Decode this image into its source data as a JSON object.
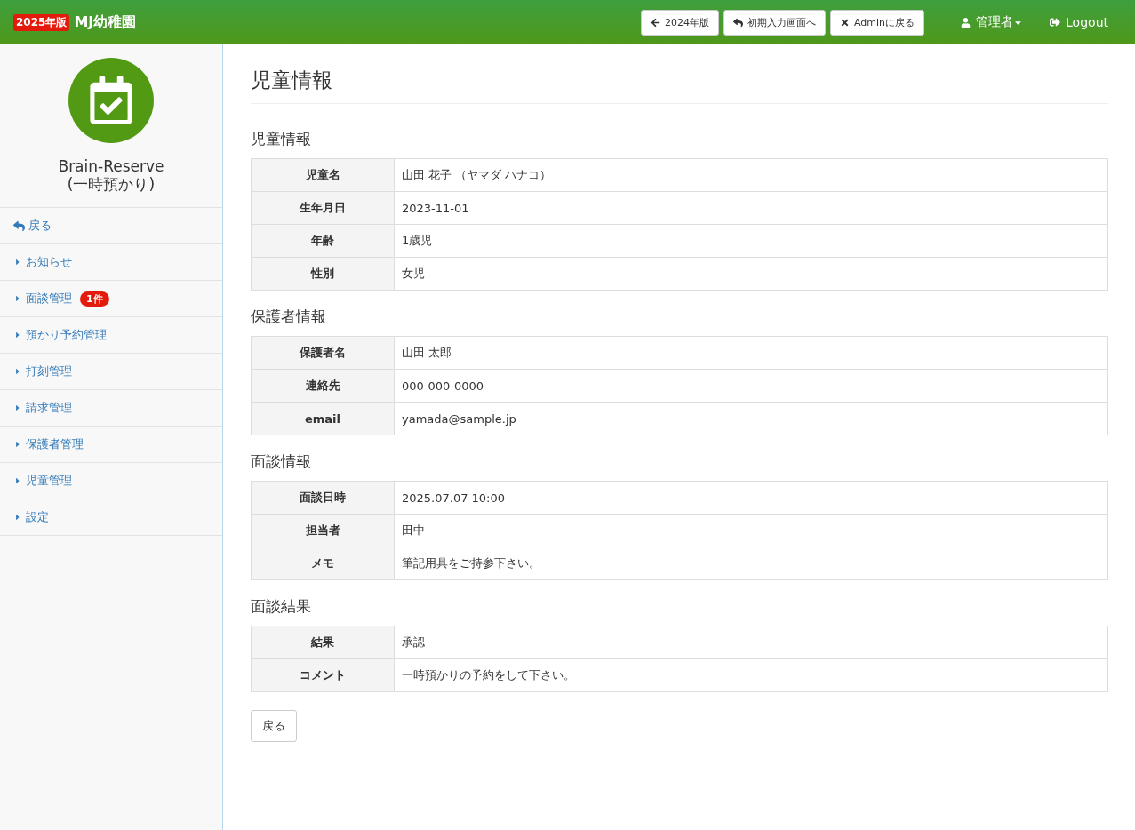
{
  "navbar": {
    "edition_badge": "2025年版",
    "brand": "MJ幼稚園",
    "buttons": [
      {
        "label": "2024年版",
        "kind": "previous"
      },
      {
        "label": "初期入力画面へ",
        "kind": "return"
      },
      {
        "label": "Adminに戻る",
        "kind": "exit"
      }
    ],
    "user_menu": "管理者",
    "logout": "Logout"
  },
  "sidebar": {
    "app_name": "Brain-Reserve",
    "app_subtitle": "(一時預かり)",
    "items": [
      {
        "kind": "back",
        "label": "戻る"
      },
      {
        "kind": "link",
        "label": "お知らせ"
      },
      {
        "kind": "link",
        "label": "面談管理",
        "badge": "1件"
      },
      {
        "kind": "link",
        "label": "預かり予約管理"
      },
      {
        "kind": "link",
        "label": "打刻管理"
      },
      {
        "kind": "link",
        "label": "請求管理"
      },
      {
        "kind": "link",
        "label": "保護者管理"
      },
      {
        "kind": "link",
        "label": "児童管理"
      },
      {
        "kind": "link",
        "label": "設定"
      }
    ]
  },
  "page_title": "児童情報",
  "sections": [
    {
      "heading": "児童情報",
      "rows": [
        {
          "label": "児童名",
          "value": "山田 花子 （ヤマダ ハナコ）"
        },
        {
          "label": "生年月日",
          "value": "2023-11-01"
        },
        {
          "label": "年齢",
          "value": "1歳児"
        },
        {
          "label": "性別",
          "value": "女児"
        }
      ]
    },
    {
      "heading": "保護者情報",
      "rows": [
        {
          "label": "保護者名",
          "value": "山田 太郎"
        },
        {
          "label": "連絡先",
          "value": "000-000-0000"
        },
        {
          "label": "email",
          "value": "yamada@sample.jp"
        }
      ]
    },
    {
      "heading": "面談情報",
      "rows": [
        {
          "label": "面談日時",
          "value": "2025.07.07 10:00"
        },
        {
          "label": "担当者",
          "value": "田中"
        },
        {
          "label": "メモ",
          "value": "筆記用具をご持参下さい。"
        }
      ]
    },
    {
      "heading": "面談結果",
      "rows": [
        {
          "label": "結果",
          "value": "承認"
        },
        {
          "label": "コメント",
          "value": "一時預かりの予約をして下さい。"
        }
      ]
    }
  ],
  "back_button": "戻る"
}
